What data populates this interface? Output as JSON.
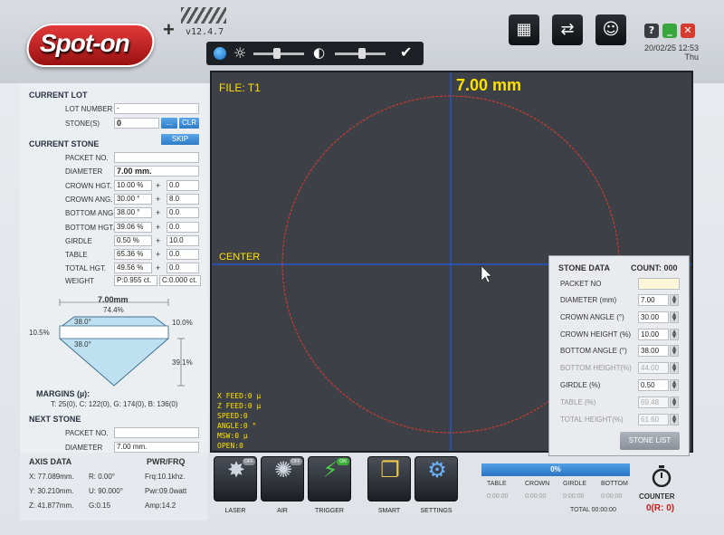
{
  "header": {
    "brand": "Spot-on",
    "brand_plus": "+",
    "version": "v12.4.7",
    "date": "20/02/25 12:53",
    "day": "Thu",
    "help_label": "?"
  },
  "current_lot": {
    "title": "CURRENT LOT",
    "lot_number_label": "LOT NUMBER",
    "lot_number_value": "-",
    "stones_label": "STONE(S)",
    "stones_value": "0",
    "browse_label": "...",
    "clear_label": "CLR",
    "skip_label": "SKIP"
  },
  "current_stone": {
    "title": "CURRENT STONE",
    "rows": [
      {
        "label": "PACKET NO.",
        "value": "",
        "delta": ""
      },
      {
        "label": "DIAMETER",
        "value": "7.00 mm.",
        "delta": ""
      },
      {
        "label": "CROWN HGT.",
        "value": "10.00 %",
        "delta": "0.0"
      },
      {
        "label": "CROWN ANG.",
        "value": "30.00 °",
        "delta": "8.0"
      },
      {
        "label": "BOTTOM ANG.",
        "value": "38.00 °",
        "delta": "0.0"
      },
      {
        "label": "BOTTOM HGT.",
        "value": "39.06 %",
        "delta": "0.0"
      },
      {
        "label": "GIRDLE",
        "value": "0.50 %",
        "delta": "10.0"
      },
      {
        "label": "TABLE",
        "value": "65.36 %",
        "delta": "0.0"
      },
      {
        "label": "TOTAL HGT.",
        "value": "49.56 %",
        "delta": "0.0"
      }
    ],
    "weight_label": "WEIGHT",
    "weight_p": "P:0.955 ct.",
    "weight_c": "C:0.000 ct."
  },
  "diagram": {
    "diameter": "7.00mm",
    "table_pct": "74.4%",
    "crown_angle": "38.0°",
    "bottom_angle": "38.0°",
    "crown_height": "10.0%",
    "girdle_left": "10.5%",
    "pavilion": "39.1%"
  },
  "margins": {
    "title": "MARGINS (µ):",
    "values": "T: 25(0), C: 122(0), G: 174(0), B: 136(0)"
  },
  "next_stone": {
    "title": "NEXT STONE",
    "packet_label": "PACKET NO.",
    "packet_value": "",
    "diameter_label": "DIAMETER",
    "diameter_value": "7.00 mm."
  },
  "axis_data": {
    "title": "AXIS DATA",
    "x": "X: 77.089mm.",
    "y": "Y: 30.210mm.",
    "z": "Z: 41.877mm.",
    "r": "R: 0.00°",
    "u": "U: 90.000°",
    "g": "G:0.15",
    "pwr_title": "PWR/FRQ",
    "frq": "Frq:10.1khz.",
    "pwr": "Pwr:09.0watt",
    "amp": "Amp:14.2"
  },
  "view": {
    "file": "FILE: T1",
    "diameter": "7.00 mm",
    "center": "CENTER",
    "readouts": [
      "X FEED:0 µ",
      "Z FEED:0 µ",
      "SPEED:0",
      "ANGLE:0 °",
      "MSW:0 µ",
      "OPEN:0"
    ]
  },
  "stone_data": {
    "title": "STONE DATA",
    "count": "COUNT: 000",
    "packet_label": "PACKET NO",
    "rows": [
      {
        "label": "DIAMETER (mm)",
        "value": "7.00",
        "enabled": true
      },
      {
        "label": "CROWN ANGLE (°)",
        "value": "30.00",
        "enabled": true
      },
      {
        "label": "CROWN HEIGHT (%)",
        "value": "10.00",
        "enabled": true
      },
      {
        "label": "BOTTOM ANGLE (°)",
        "value": "38.00",
        "enabled": true
      },
      {
        "label": "BOTTOM HEIGHT(%)",
        "value": "44.00",
        "enabled": false
      },
      {
        "label": "GIRDLE (%)",
        "value": "0.50",
        "enabled": true
      },
      {
        "label": "TABLE (%)",
        "value": "69.48",
        "enabled": false
      },
      {
        "label": "TOTAL HEIGHT(%)",
        "value": "61.60",
        "enabled": false
      }
    ],
    "stone_list_label": "STONE LIST"
  },
  "bottom": {
    "buttons": [
      {
        "label": "LASER",
        "icon": "laser-icon",
        "badge": "OFF"
      },
      {
        "label": "AIR",
        "icon": "fan-icon",
        "badge": "OFF"
      },
      {
        "label": "TRIGGER",
        "icon": "lightning-icon",
        "badge": "ON"
      },
      {
        "label": "SMART",
        "icon": "documents-icon",
        "badge": ""
      },
      {
        "label": "SETTINGS",
        "icon": "gear-icon",
        "badge": ""
      }
    ],
    "progress_label": "0%",
    "progress_value": 0,
    "table_headers": [
      "TABLE",
      "CROWN",
      "GIRDLE",
      "BOTTOM"
    ],
    "table_values": [
      "0:00:00",
      "0:00:00",
      "0:00:00",
      "0:00:00"
    ],
    "total": "TOTAL 00:00:00",
    "counter_label": "COUNTER",
    "counter_value": "0(R: 0)"
  }
}
